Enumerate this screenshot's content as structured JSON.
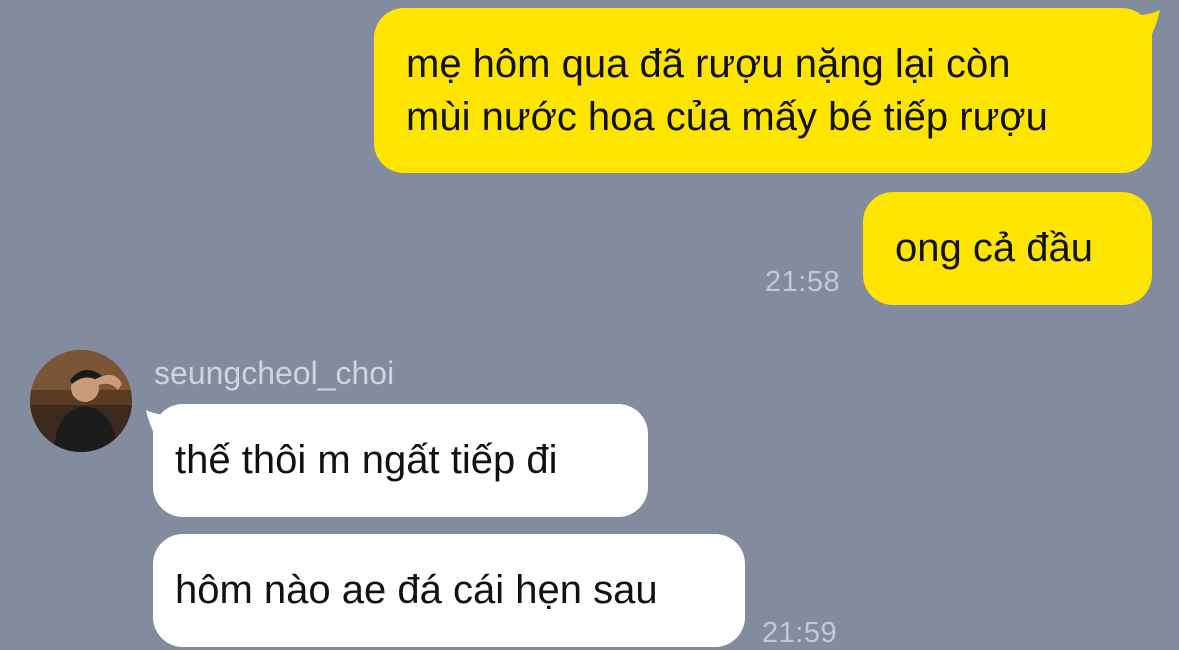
{
  "colors": {
    "background": "#838b9e",
    "outgoing_bubble": "#fee500",
    "incoming_bubble": "#ffffff",
    "timestamp": "#c3c8d3"
  },
  "messages_out": [
    {
      "line1": "mẹ hôm qua đã rượu nặng lại còn",
      "line2": "mùi nước hoa của mấy bé tiếp rượu"
    },
    {
      "text": "ong cả đầu",
      "time": "21:58"
    }
  ],
  "contact": {
    "name": "seungcheol_choi",
    "avatar_icon": "user-avatar-photo"
  },
  "messages_in": [
    {
      "text": "thế thôi m ngất tiếp đi"
    },
    {
      "text": "hôm nào ae đá cái hẹn sau",
      "time": "21:59"
    }
  ]
}
